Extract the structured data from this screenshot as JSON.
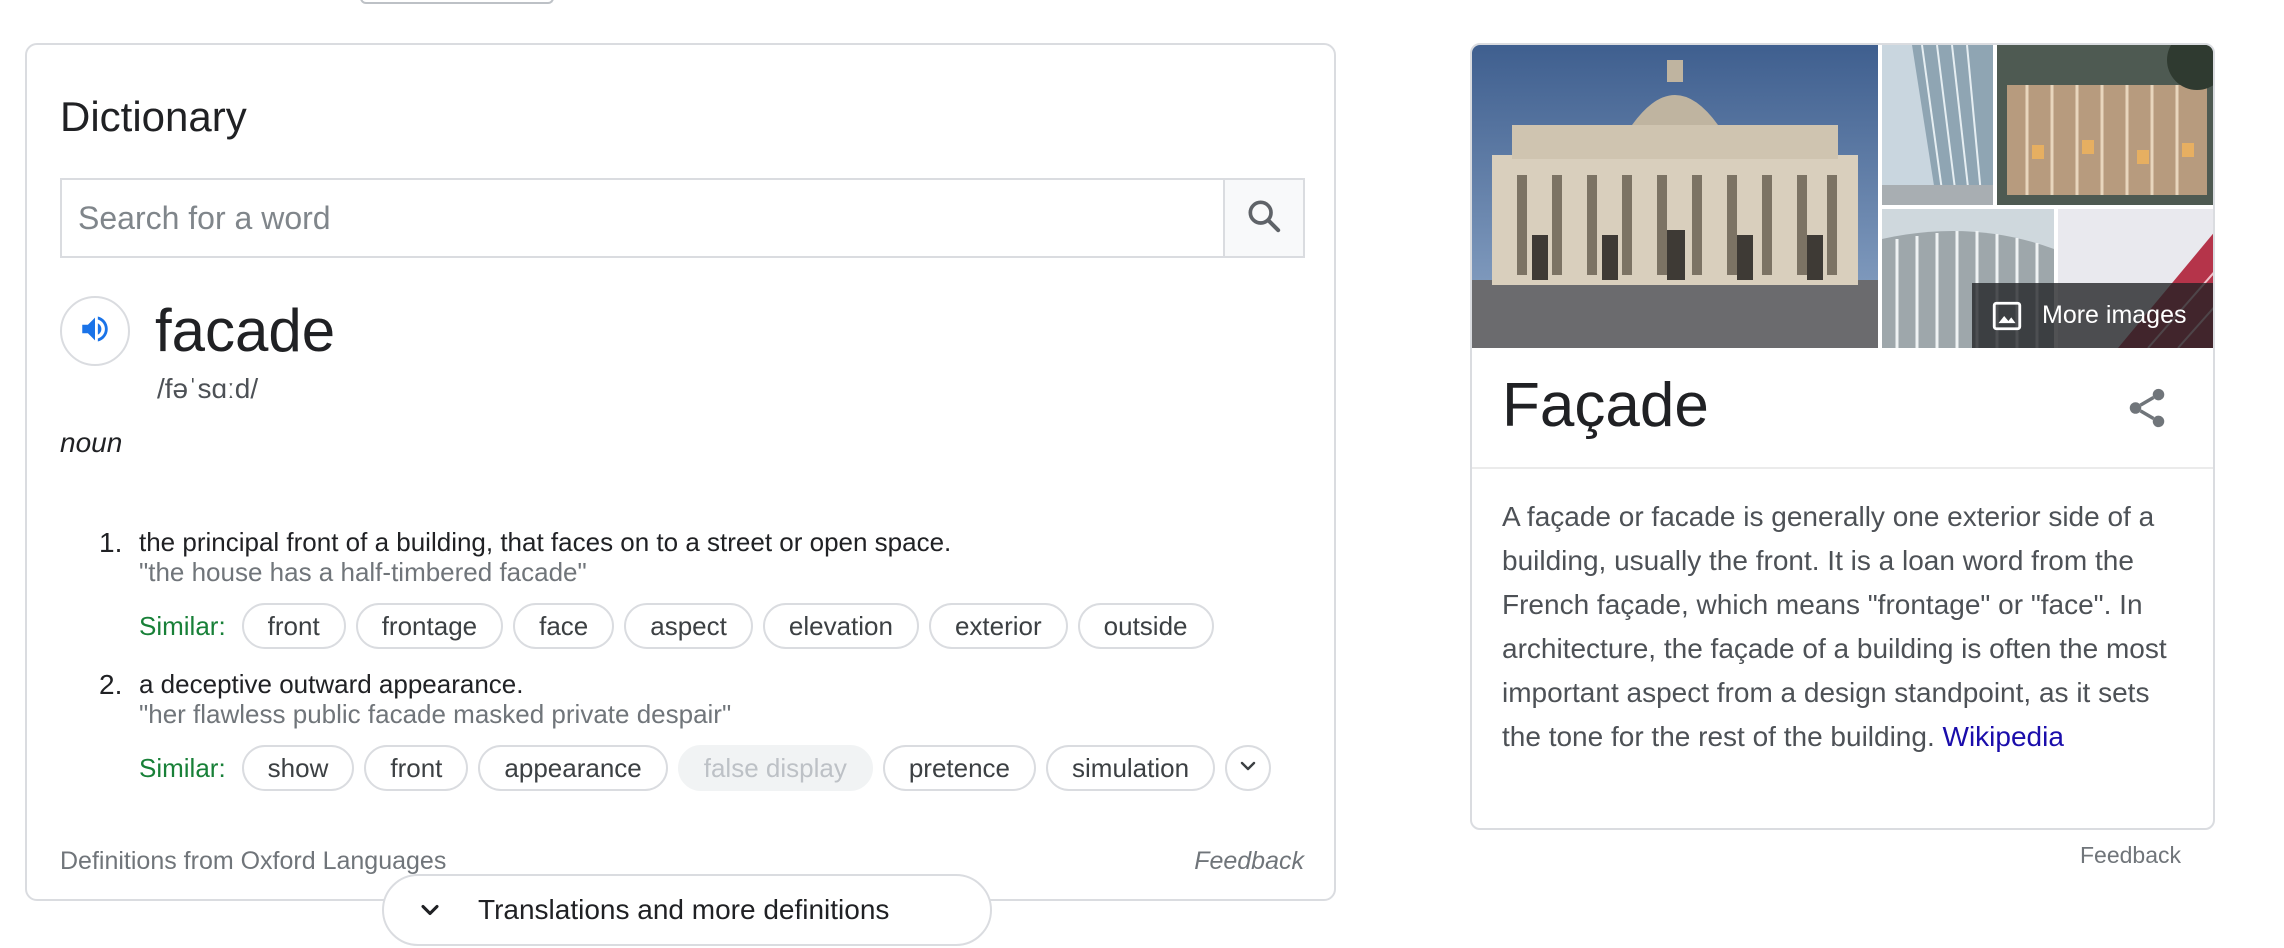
{
  "dictionary": {
    "title": "Dictionary",
    "search_placeholder": "Search for a word",
    "headword": "facade",
    "phonetic": "/fəˈsɑːd/",
    "part_of_speech": "noun",
    "similar_label": "Similar:",
    "senses": [
      {
        "number": "1.",
        "definition": "the principal front of a building, that faces on to a street or open space.",
        "example": "\"the house has a half-timbered facade\"",
        "similar": [
          "front",
          "frontage",
          "face",
          "aspect",
          "elevation",
          "exterior",
          "outside"
        ]
      },
      {
        "number": "2.",
        "definition": "a deceptive outward appearance.",
        "example": "\"her flawless public facade masked private despair\"",
        "similar": [
          "show",
          "front",
          "appearance",
          "false display",
          "pretence",
          "simulation"
        ]
      }
    ],
    "source": "Definitions from Oxford Languages",
    "feedback": "Feedback",
    "translations_button": "Translations and more definitions"
  },
  "knowledge_panel": {
    "title": "Façade",
    "more_images_label": "More images",
    "description": "A façade or facade is generally one exterior side of a building, usually the front. It is a loan word from the French façade, which means \"frontage\" or \"face\". In architecture, the façade of a building is often the most important aspect from a design standpoint, as it sets the tone for the rest of the building.",
    "source_link": "Wikipedia",
    "feedback": "Feedback"
  },
  "colors": {
    "similar_label": "#188038",
    "link": "#1a0dab",
    "speaker": "#1a73e8",
    "border": "#dadce0"
  },
  "icons": [
    "search-icon",
    "speaker-icon",
    "chevron-down-icon",
    "image-icon",
    "share-icon"
  ]
}
